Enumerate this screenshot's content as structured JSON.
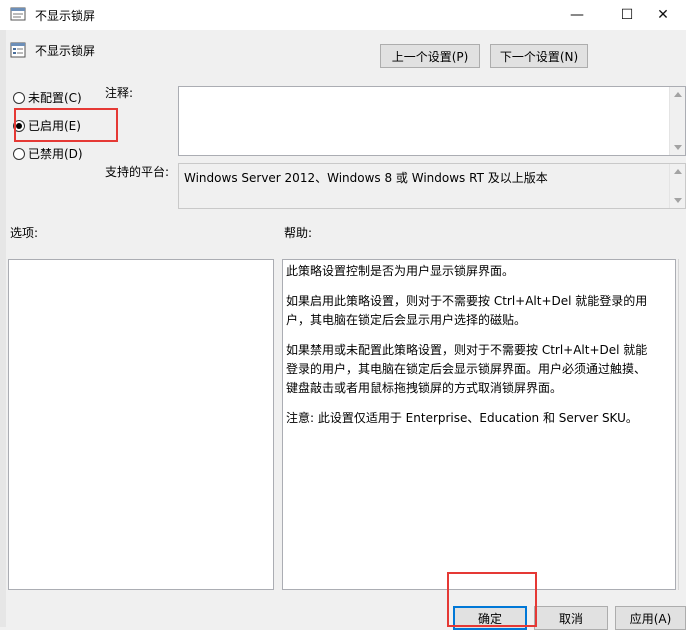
{
  "window": {
    "title": "不显示锁屏",
    "controls": {
      "minimize": "—",
      "maximize": "☐",
      "close": "✕"
    }
  },
  "header": {
    "policy_title": "不显示锁屏",
    "prev_button": "上一个设置(P)",
    "next_button": "下一个设置(N)"
  },
  "state": {
    "options": [
      {
        "label": "未配置(C)",
        "checked": false
      },
      {
        "label": "已启用(E)",
        "checked": true
      },
      {
        "label": "已禁用(D)",
        "checked": false
      }
    ]
  },
  "comment": {
    "label": "注释:",
    "value": ""
  },
  "platform": {
    "label": "支持的平台:",
    "value": "Windows Server 2012、Windows 8 或 Windows RT 及以上版本"
  },
  "options_label": "选项:",
  "help": {
    "label": "帮助:",
    "paragraphs": [
      "此策略设置控制是否为用户显示锁屏界面。",
      "如果启用此策略设置，则对于不需要按 Ctrl+Alt+Del 就能登录的用户，其电脑在锁定后会显示用户选择的磁贴。",
      "如果禁用或未配置此策略设置，则对于不需要按 Ctrl+Alt+Del 就能登录的用户，其电脑在锁定后会显示锁屏界面。用户必须通过触摸、键盘敲击或者用鼠标拖拽锁屏的方式取消锁屏界面。",
      "注意: 此设置仅适用于 Enterprise、Education 和 Server SKU。"
    ]
  },
  "footer": {
    "ok": "确定",
    "cancel": "取消",
    "apply": "应用(A)"
  },
  "colors": {
    "highlight_box": "#e53935",
    "focus_border": "#0078d7"
  }
}
